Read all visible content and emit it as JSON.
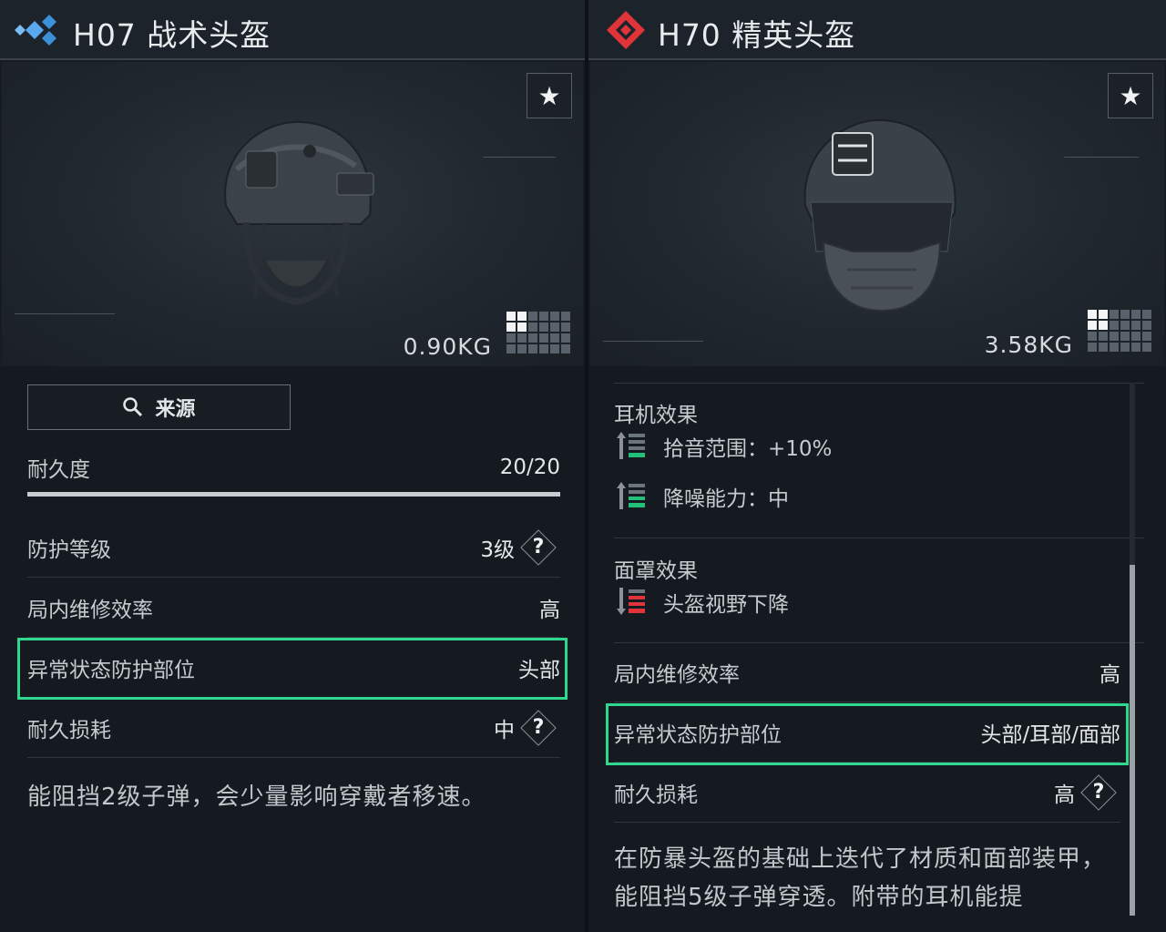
{
  "left": {
    "title": "H07 战术头盔",
    "rarity_icon": "blue-diamonds-icon",
    "weight": "0.90KG",
    "source_label": "来源",
    "durability": {
      "label": "耐久度",
      "value": "20/20",
      "fraction": 1.0
    },
    "rows": [
      {
        "label": "防护等级",
        "value": "3级",
        "help": "?"
      },
      {
        "label": "局内维修效率",
        "value": "高"
      },
      {
        "label": "异常状态防护部位",
        "value": "头部"
      },
      {
        "label": "耐久损耗",
        "value": "中",
        "help": "?"
      }
    ],
    "description": "能阻挡2级子弹，会少量影响穿戴者移速。"
  },
  "right": {
    "title": "H70 精英头盔",
    "rarity_icon": "red-diamond-icon",
    "weight": "3.58KG",
    "headset": {
      "label": "耳机效果",
      "effects": [
        {
          "text": "拾音范围：+10%",
          "icon": "green-level-up-icon"
        },
        {
          "text": "降噪能力：中",
          "icon": "green-level-up-icon"
        }
      ]
    },
    "mask": {
      "label": "面罩效果",
      "effects": [
        {
          "text": "头盔视野下降",
          "icon": "red-level-down-icon"
        }
      ]
    },
    "rows": [
      {
        "label": "局内维修效率",
        "value": "高"
      },
      {
        "label": "异常状态防护部位",
        "value": "头部/耳部/面部"
      },
      {
        "label": "耐久损耗",
        "value": "高",
        "help": "?"
      }
    ],
    "description": "在防暴头盔的基础上迭代了材质和面部装甲，能阻挡5级子弹穿透。附带的耳机能提"
  },
  "colors": {
    "highlight": "#2fd78f",
    "accent_red": "#e0343a",
    "accent_blue": "#4a9ee8",
    "effect_green": "#22c07a"
  }
}
